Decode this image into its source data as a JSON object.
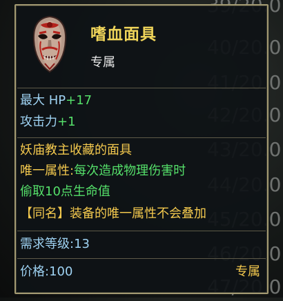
{
  "background_list": [
    "39/20.0",
    "40/20.0",
    "41/20.0",
    "42/20.0",
    "43/20.0",
    "44/20.0",
    "45/20.0",
    "46/20.0",
    "47/20.0"
  ],
  "item": {
    "name": "嗜血面具",
    "tag": "专属",
    "icon": "blood-mask-icon"
  },
  "stats": {
    "stat1_label": "最大 HP",
    "stat1_value": "+17",
    "stat2_label": "攻击力",
    "stat2_value": "+1"
  },
  "description": {
    "lore": "妖庙教主收藏的面具",
    "unique_label": "唯一属性:",
    "unique_effect_line1": "每次造成物理伤害时",
    "unique_effect_line2": "偷取10点生命值",
    "same_name_note": "【同名】装备的唯一属性不会叠加"
  },
  "requirement": {
    "label": "需求等级:",
    "value": "13"
  },
  "footer": {
    "price_label": "价格:",
    "price_value": "100",
    "binding": "专属"
  },
  "colors": {
    "name_gold": "#f0d55a",
    "stat_blue": "#9fd3f3",
    "bonus_green": "#55e06a",
    "desc_gold": "#f4c94e",
    "border": "#a39a72"
  }
}
